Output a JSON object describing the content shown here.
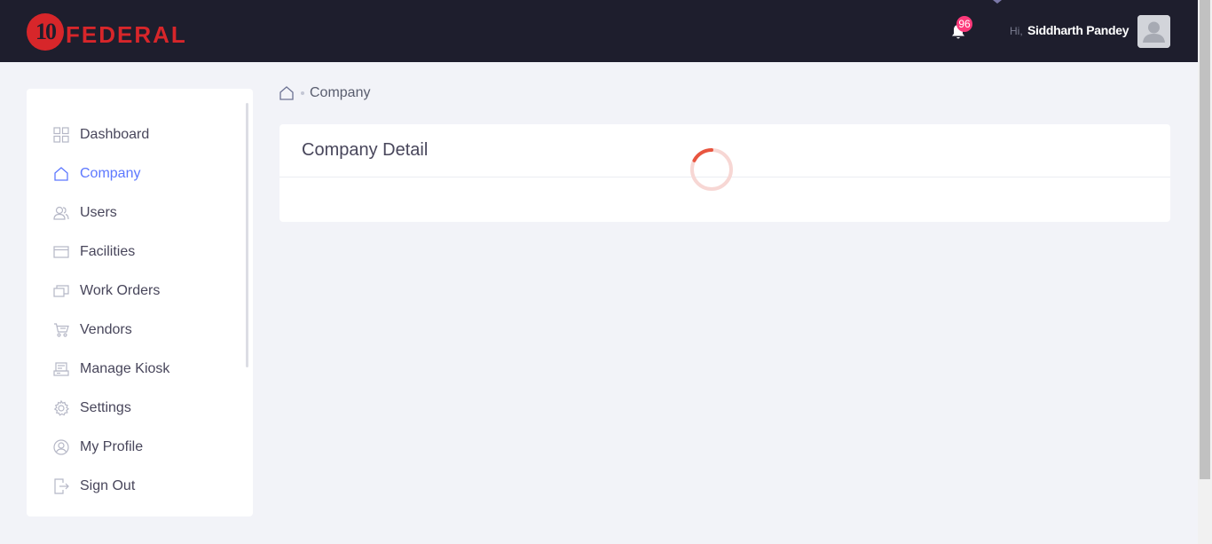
{
  "header": {
    "logo_number": "10",
    "logo_text": "FEDERAL",
    "notification_count": "96",
    "greeting": "Hi,",
    "user_name": "Siddharth Pandey",
    "bell_icon": "bell-icon",
    "avatar_icon": "user-avatar-icon"
  },
  "sidebar": {
    "items": [
      {
        "label": "Dashboard",
        "icon": "dashboard-icon",
        "active": false
      },
      {
        "label": "Company",
        "icon": "home-icon",
        "active": true
      },
      {
        "label": "Users",
        "icon": "users-icon",
        "active": false
      },
      {
        "label": "Facilities",
        "icon": "facilities-icon",
        "active": false
      },
      {
        "label": "Work Orders",
        "icon": "work-orders-icon",
        "active": false
      },
      {
        "label": "Vendors",
        "icon": "vendors-cart-icon",
        "active": false
      },
      {
        "label": "Manage Kiosk",
        "icon": "kiosk-icon",
        "active": false
      },
      {
        "label": "Settings",
        "icon": "gear-icon",
        "active": false
      },
      {
        "label": "My Profile",
        "icon": "profile-icon",
        "active": false
      },
      {
        "label": "Sign Out",
        "icon": "sign-out-icon",
        "active": false
      }
    ]
  },
  "breadcrumb": {
    "home_icon": "home-icon",
    "current": "Company"
  },
  "main": {
    "card_title": "Company Detail",
    "loading": true
  },
  "colors": {
    "topbar": "#1e1e2d",
    "brand_red": "#d7262a",
    "active": "#5d78ff",
    "badge": "#fd397a",
    "background": "#f2f3f8"
  }
}
